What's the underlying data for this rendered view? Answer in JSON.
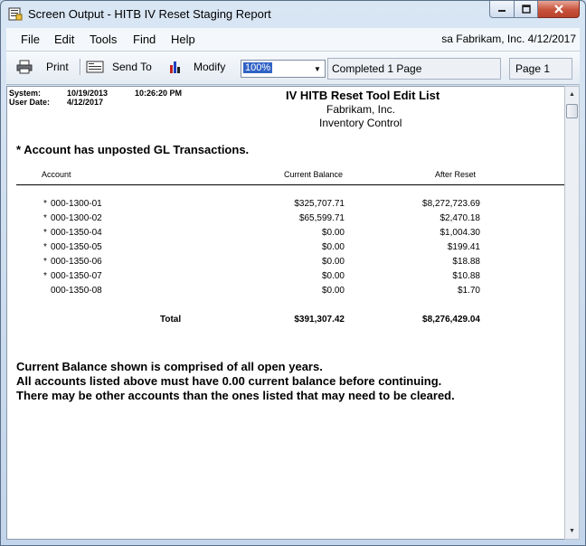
{
  "window": {
    "title": "Screen Output - HITB IV Reset Staging Report"
  },
  "menu": {
    "items": [
      "File",
      "Edit",
      "Tools",
      "Find",
      "Help"
    ],
    "user_info": "sa  Fabrikam, Inc.  4/12/2017"
  },
  "toolbar": {
    "print_label": "Print",
    "send_to_label": "Send To",
    "modify_label": "Modify",
    "zoom_value": "100%",
    "status_text": "Completed 1 Page",
    "page_text": "Page 1"
  },
  "report": {
    "system_label": "System:",
    "system_date": "10/19/2013",
    "system_time": "10:26:20 PM",
    "user_date_label": "User Date:",
    "user_date": "4/12/2017",
    "title": "IV HITB Reset Tool Edit List",
    "company": "Fabrikam, Inc.",
    "module": "Inventory Control",
    "legend": "* Account has unposted GL Transactions.",
    "columns": {
      "account": "Account",
      "current_balance": "Current Balance",
      "after_reset": "After Reset"
    },
    "rows": [
      {
        "flag": "*",
        "account": "000-1300-01",
        "current": "$325,707.71",
        "after": "$8,272,723.69"
      },
      {
        "flag": "*",
        "account": "000-1300-02",
        "current": "$65,599.71",
        "after": "$2,470.18"
      },
      {
        "flag": "*",
        "account": "000-1350-04",
        "current": "$0.00",
        "after": "$1,004.30"
      },
      {
        "flag": "*",
        "account": "000-1350-05",
        "current": "$0.00",
        "after": "$199.41"
      },
      {
        "flag": "*",
        "account": "000-1350-06",
        "current": "$0.00",
        "after": "$18.88"
      },
      {
        "flag": "*",
        "account": "000-1350-07",
        "current": "$0.00",
        "after": "$10.88"
      },
      {
        "flag": "",
        "account": "000-1350-08",
        "current": "$0.00",
        "after": "$1.70"
      }
    ],
    "total_label": "Total",
    "total_current": "$391,307.42",
    "total_after": "$8,276,429.04",
    "notes": [
      "Current Balance shown is comprised of all open years.",
      "All accounts listed above must have 0.00 current balance before continuing.",
      "There may be other accounts than the ones listed that may need to be cleared."
    ]
  }
}
